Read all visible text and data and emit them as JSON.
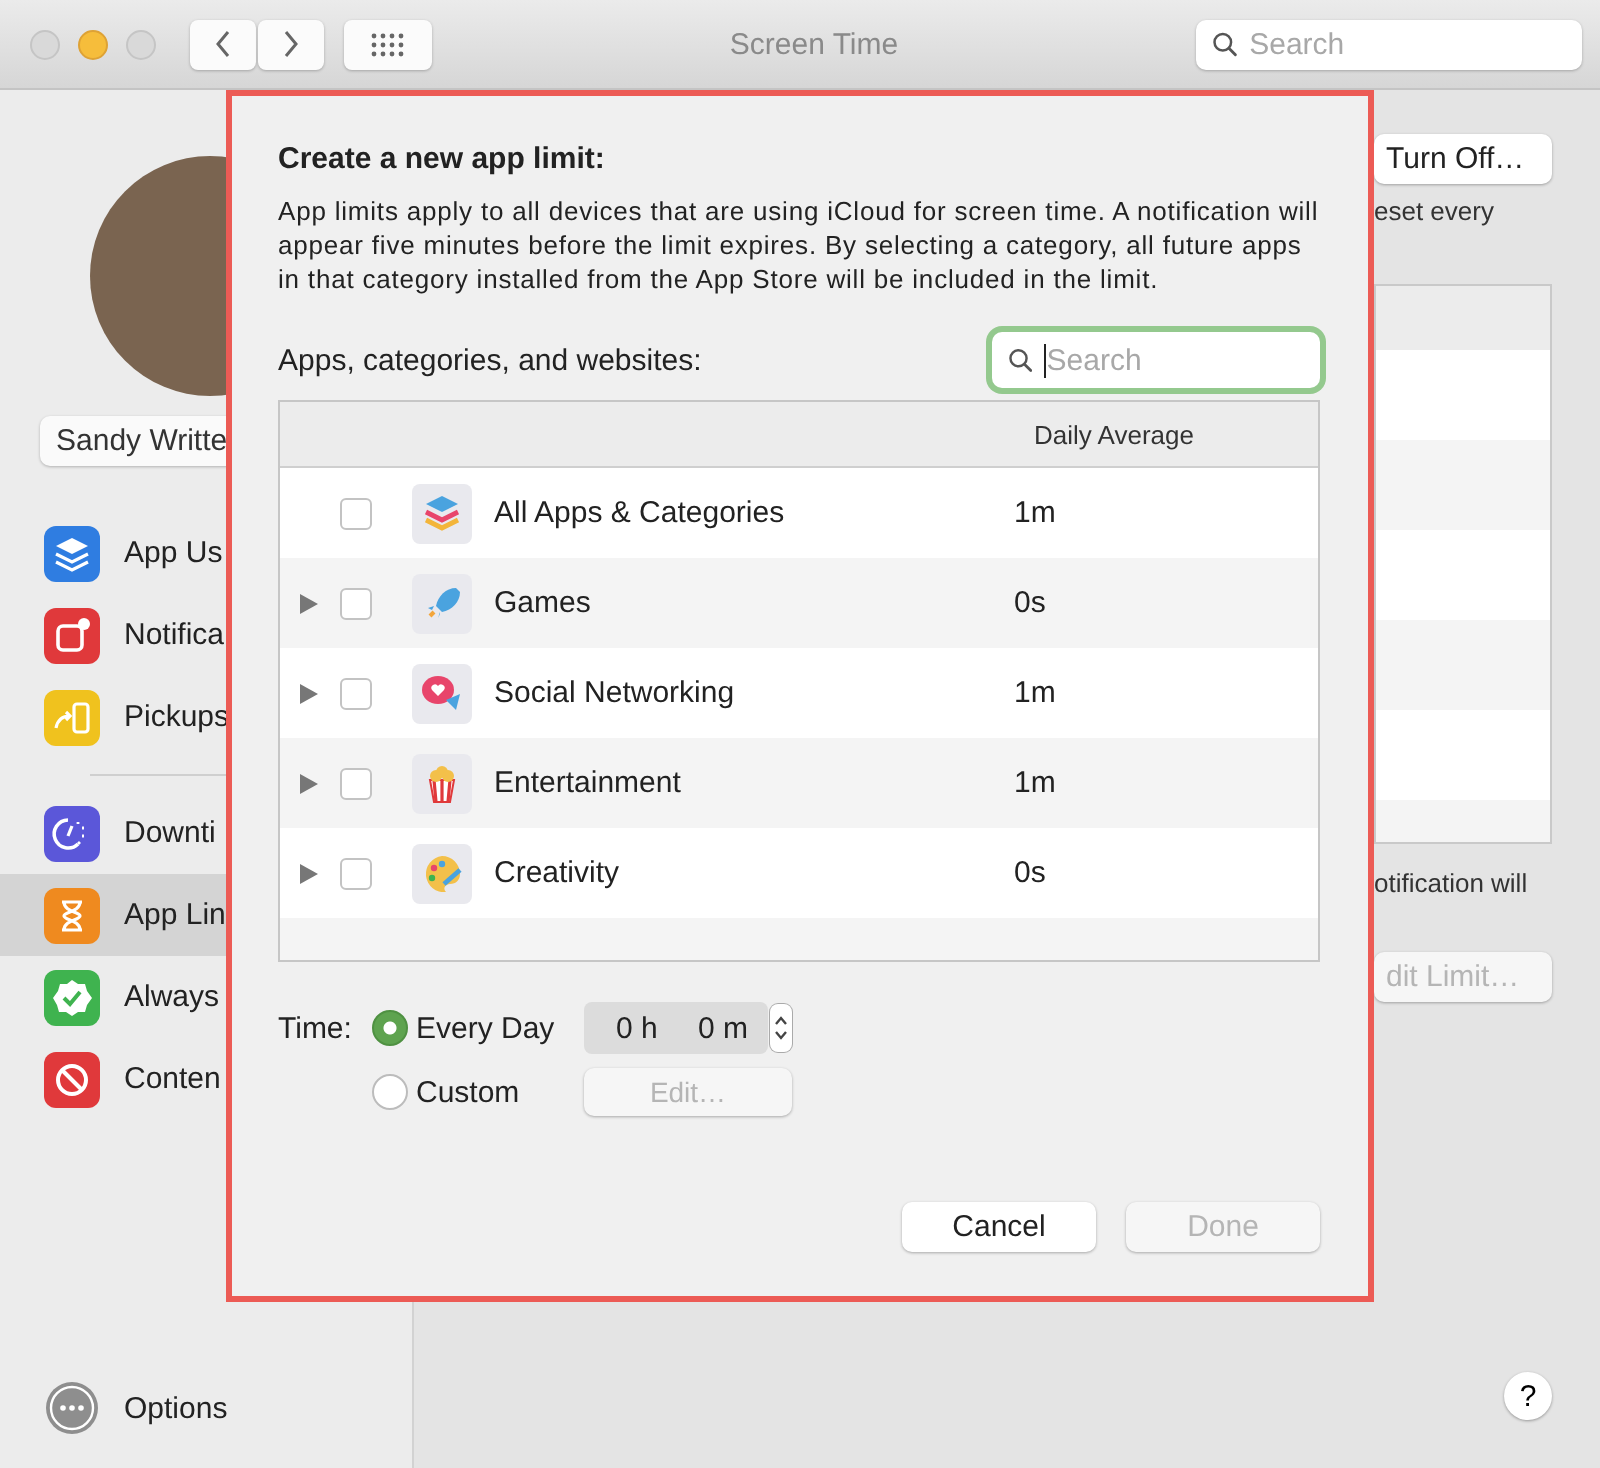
{
  "window": {
    "title": "Screen Time",
    "search": {
      "placeholder": "Search"
    }
  },
  "sidebar": {
    "user_name": "Sandy Writte",
    "sections": [
      {
        "items": [
          {
            "label": "App Us",
            "selected": false
          },
          {
            "label": "Notifica",
            "selected": false
          },
          {
            "label": "Pickups",
            "selected": false
          }
        ]
      },
      {
        "items": [
          {
            "label": "Downti",
            "selected": false
          },
          {
            "label": "App Lin",
            "selected": true
          },
          {
            "label": "Always",
            "selected": false
          },
          {
            "label": "Conten",
            "selected": false
          }
        ]
      }
    ],
    "options": {
      "label": "Options"
    }
  },
  "content": {
    "turn_off_button": "Turn Off…",
    "text_1": "eset every",
    "text_2": "otification will",
    "edit_limit_button": {
      "label": "dit Limit…",
      "disabled": true
    },
    "help_button": "?"
  },
  "dialog": {
    "title": "Create a new app limit:",
    "description": "App limits apply to all devices that are using iCloud for screen time. A notification will appear five minutes before the limit expires. By selecting a category, all future apps in that category installed from the App Store will be included in the limit.",
    "list_label": "Apps, categories, and websites:",
    "search": {
      "placeholder": "Search",
      "focused": true
    },
    "table": {
      "columns": [
        "Daily Average"
      ],
      "rows": [
        {
          "kind": "total",
          "name": "All Apps & Categories",
          "average": "1m",
          "checked": false
        },
        {
          "kind": "category",
          "name": "Games",
          "average": "0s",
          "checked": false,
          "expanded": false
        },
        {
          "kind": "category",
          "name": "Social Networking",
          "average": "1m",
          "checked": false,
          "expanded": false
        },
        {
          "kind": "category",
          "name": "Entertainment",
          "average": "1m",
          "checked": false,
          "expanded": false
        },
        {
          "kind": "category",
          "name": "Creativity",
          "average": "0s",
          "checked": false,
          "expanded": false
        }
      ]
    },
    "time": {
      "label": "Time:",
      "options": [
        {
          "label": "Every Day",
          "selected": true
        },
        {
          "label": "Custom",
          "selected": false
        }
      ],
      "hours": "0 h",
      "minutes": "0 m",
      "edit_button": {
        "label": "Edit…",
        "disabled": true
      }
    },
    "buttons": [
      {
        "label": "Cancel",
        "disabled": false
      },
      {
        "label": "Done",
        "disabled": true
      }
    ]
  }
}
